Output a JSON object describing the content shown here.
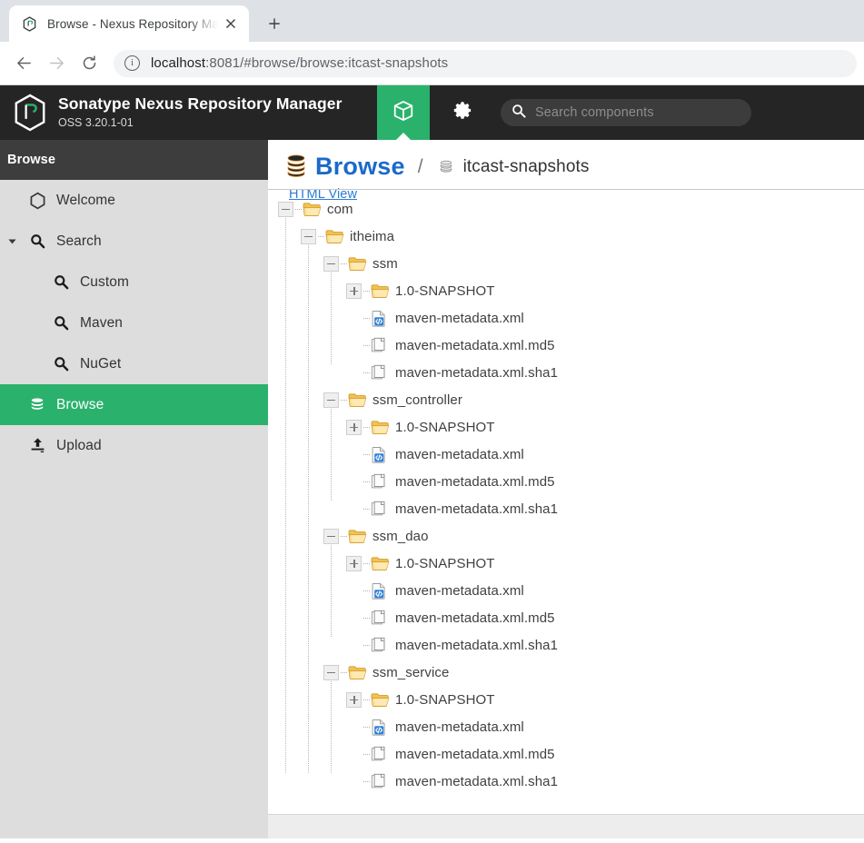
{
  "browser": {
    "tab": {
      "title": "Browse - Nexus Repository Ma",
      "favicon_icon": "nexus-favicon-icon",
      "close_icon": "close-icon"
    },
    "newtab_icon": "plus-icon",
    "back_icon": "back-arrow-icon",
    "forward_icon": "forward-arrow-icon",
    "reload_icon": "reload-icon",
    "omnibox": {
      "info_icon": "info-circle-icon",
      "url_host": "localhost",
      "url_rest": ":8081/#browse/browse:itcast-snapshots"
    }
  },
  "app_header": {
    "logo_icon": "nexus-hex-logo-icon",
    "title": "Sonatype Nexus Repository Manager",
    "version": "OSS 3.20.1-01",
    "browse_tab_icon": "cube-icon",
    "gear_icon": "gear-icon",
    "search": {
      "icon": "search-icon",
      "placeholder": "Search components",
      "value": ""
    },
    "accent_green": "#2ab26c",
    "background": "#252525"
  },
  "sidebar": {
    "header": "Browse",
    "items": [
      {
        "label": "Welcome",
        "icon": "hexagon-icon",
        "level": 1,
        "selected": false,
        "twisty": ""
      },
      {
        "label": "Search",
        "icon": "search-icon",
        "level": 1,
        "selected": false,
        "twisty": "chevron-down-icon"
      },
      {
        "label": "Custom",
        "icon": "search-icon",
        "level": 2,
        "selected": false,
        "twisty": ""
      },
      {
        "label": "Maven",
        "icon": "search-icon",
        "level": 2,
        "selected": false,
        "twisty": ""
      },
      {
        "label": "NuGet",
        "icon": "search-icon",
        "level": 2,
        "selected": false,
        "twisty": ""
      },
      {
        "label": "Browse",
        "icon": "database-icon",
        "level": 1,
        "selected": true,
        "twisty": ""
      },
      {
        "label": "Upload",
        "icon": "upload-icon",
        "level": 1,
        "selected": false,
        "twisty": ""
      }
    ]
  },
  "main": {
    "breadcrumb": {
      "root_icon": "database-stack-icon",
      "root_label": "Browse",
      "separator": "/",
      "repo_icon": "repository-icon",
      "repo_label": "itcast-snapshots"
    },
    "html_view_link": "HTML View",
    "tree": [
      {
        "label": "com",
        "depth": 0,
        "toggle": "minus",
        "icon": "folder-icon"
      },
      {
        "label": "itheima",
        "depth": 1,
        "toggle": "minus",
        "icon": "folder-icon"
      },
      {
        "label": "ssm",
        "depth": 2,
        "toggle": "minus",
        "icon": "folder-icon"
      },
      {
        "label": "1.0-SNAPSHOT",
        "depth": 3,
        "toggle": "plus",
        "icon": "folder-icon"
      },
      {
        "label": "maven-metadata.xml",
        "depth": 3,
        "toggle": "none",
        "icon": "xml-file-icon"
      },
      {
        "label": "maven-metadata.xml.md5",
        "depth": 3,
        "toggle": "none",
        "icon": "file-icon"
      },
      {
        "label": "maven-metadata.xml.sha1",
        "depth": 3,
        "toggle": "none",
        "icon": "file-icon"
      },
      {
        "label": "ssm_controller",
        "depth": 2,
        "toggle": "minus",
        "icon": "folder-icon"
      },
      {
        "label": "1.0-SNAPSHOT",
        "depth": 3,
        "toggle": "plus",
        "icon": "folder-icon"
      },
      {
        "label": "maven-metadata.xml",
        "depth": 3,
        "toggle": "none",
        "icon": "xml-file-icon"
      },
      {
        "label": "maven-metadata.xml.md5",
        "depth": 3,
        "toggle": "none",
        "icon": "file-icon"
      },
      {
        "label": "maven-metadata.xml.sha1",
        "depth": 3,
        "toggle": "none",
        "icon": "file-icon"
      },
      {
        "label": "ssm_dao",
        "depth": 2,
        "toggle": "minus",
        "icon": "folder-icon"
      },
      {
        "label": "1.0-SNAPSHOT",
        "depth": 3,
        "toggle": "plus",
        "icon": "folder-icon"
      },
      {
        "label": "maven-metadata.xml",
        "depth": 3,
        "toggle": "none",
        "icon": "xml-file-icon"
      },
      {
        "label": "maven-metadata.xml.md5",
        "depth": 3,
        "toggle": "none",
        "icon": "file-icon"
      },
      {
        "label": "maven-metadata.xml.sha1",
        "depth": 3,
        "toggle": "none",
        "icon": "file-icon"
      },
      {
        "label": "ssm_service",
        "depth": 2,
        "toggle": "minus",
        "icon": "folder-icon"
      },
      {
        "label": "1.0-SNAPSHOT",
        "depth": 3,
        "toggle": "plus",
        "icon": "folder-icon"
      },
      {
        "label": "maven-metadata.xml",
        "depth": 3,
        "toggle": "none",
        "icon": "xml-file-icon"
      },
      {
        "label": "maven-metadata.xml.md5",
        "depth": 3,
        "toggle": "none",
        "icon": "file-icon"
      },
      {
        "label": "maven-metadata.xml.sha1",
        "depth": 3,
        "toggle": "none",
        "icon": "file-icon"
      }
    ]
  }
}
